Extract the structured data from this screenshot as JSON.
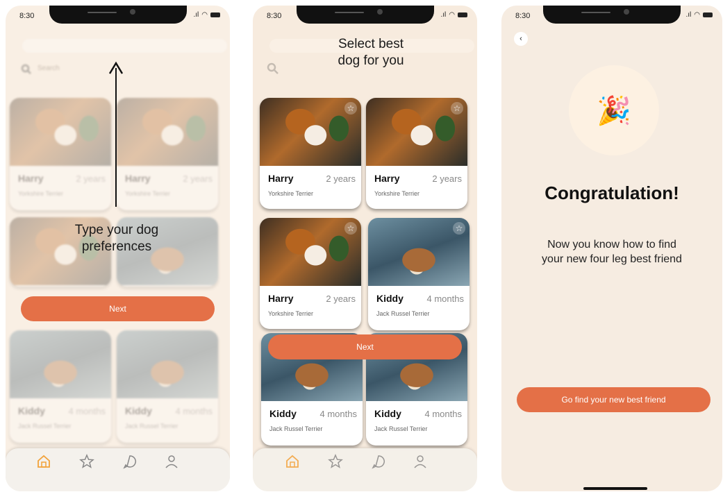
{
  "status": {
    "time": "8:30"
  },
  "screen1": {
    "search_placeholder": "Search",
    "overlay_text_line1": "Type your dog",
    "overlay_text_line2": "preferences",
    "next_label": "Next",
    "cards": [
      {
        "name": "Harry",
        "age": "2 years",
        "breed": "Yorkshire Terrier"
      },
      {
        "name": "Harry",
        "age": "2 years",
        "breed": "Yorkshire Terrier"
      },
      {
        "name": "Kiddy",
        "age": "4 months",
        "breed": "Jack Russel Terrier"
      },
      {
        "name": "Kiddy",
        "age": "4 months",
        "breed": "Jack Russel Terrier"
      }
    ]
  },
  "screen2": {
    "overlay_text_line1": "Select best",
    "overlay_text_line2": "dog for you",
    "next_label": "Next",
    "cards": [
      {
        "name": "Harry",
        "age": "2 years",
        "breed": "Yorkshire Terrier"
      },
      {
        "name": "Harry",
        "age": "2 years",
        "breed": "Yorkshire Terrier"
      },
      {
        "name": "Harry",
        "age": "2 years",
        "breed": "Yorkshire Terrier"
      },
      {
        "name": "Kiddy",
        "age": "4 months",
        "breed": "Jack Russel Terrier"
      },
      {
        "name": "Kiddy",
        "age": "4 months",
        "breed": "Jack Russel Terrier"
      },
      {
        "name": "Kiddy",
        "age": "4 months",
        "breed": "Jack Russel Terrier"
      }
    ]
  },
  "screen3": {
    "emoji": "🎉",
    "title": "Congratulation!",
    "message": "Now you know how to find your new four leg best friend",
    "cta_label": "Go find your new best friend"
  },
  "colors": {
    "accent": "#e47047",
    "tab_active": "#f2a23a",
    "background": "#f7ebde"
  },
  "tabs": [
    "home-icon",
    "star-icon",
    "chat-icon",
    "profile-icon"
  ]
}
